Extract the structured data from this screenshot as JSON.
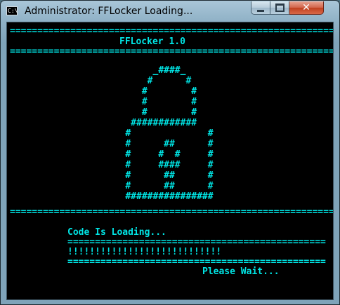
{
  "window": {
    "title": "Administrator:  FFLocker Loading...",
    "icon": "C:\\"
  },
  "controls": {
    "minimize": "minimize-icon",
    "maximize": "maximize-icon",
    "close": "✕"
  },
  "console": {
    "separator": "===================================================================",
    "heading": "FFLocker 1.0",
    "lock_art": [
      "                          _####_",
      "                         #      #",
      "                        #        #",
      "                        #        #",
      "                        #        #",
      "                      ############",
      "                     #              #",
      "                     #      ##      #",
      "                     #     #  #     #",
      "                     #     ####     #",
      "                     #      ##      #",
      "                     #      ##      #",
      "                     ################"
    ],
    "loading_label": "Code Is Loading...",
    "bar_top": "===============================================",
    "progress": "!!!!!!!!!!!!!!!!!!!!!!!!!!!!",
    "bar_bottom": "===============================================",
    "wait_text": "Please Wait..."
  },
  "colors": {
    "console_text": "#00e5e5",
    "console_bg": "#000000"
  }
}
